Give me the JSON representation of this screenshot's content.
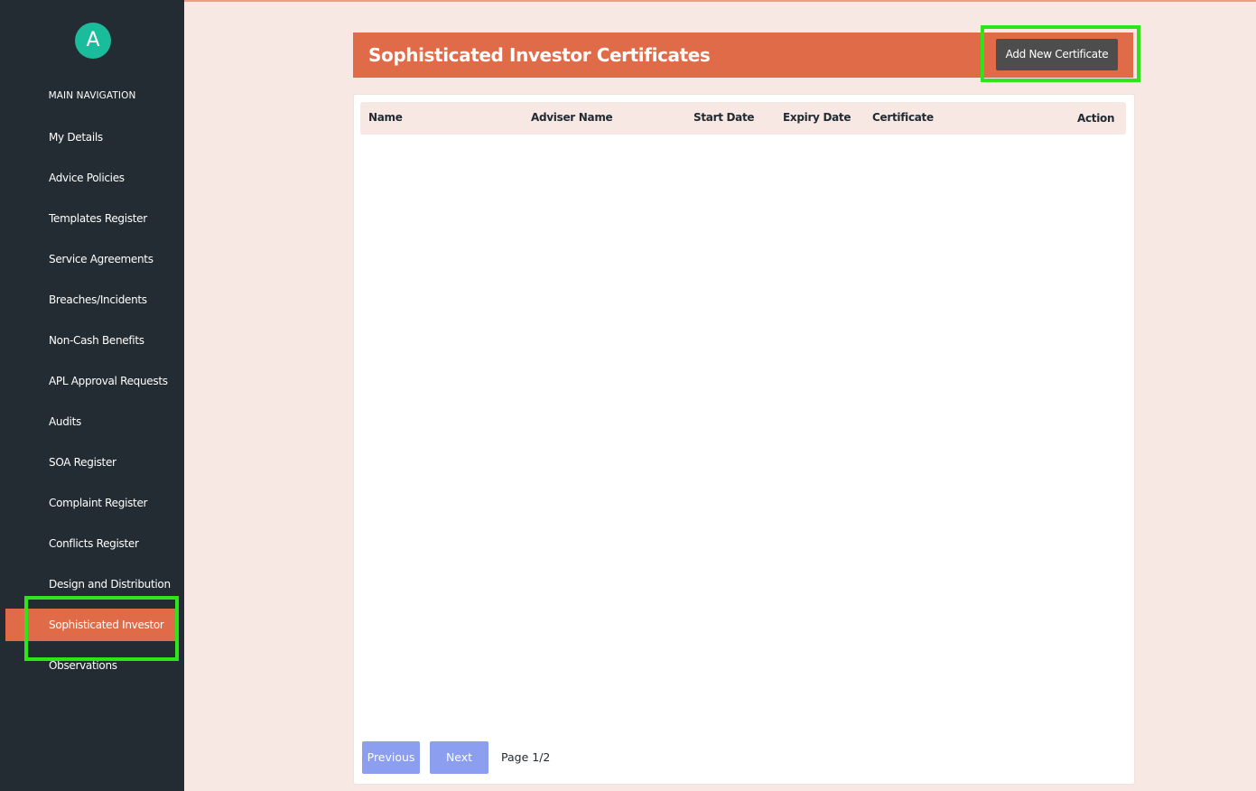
{
  "sidebar": {
    "avatar_letter": "A",
    "heading": "MAIN NAVIGATION",
    "items": [
      {
        "label": "My Details"
      },
      {
        "label": "Advice Policies"
      },
      {
        "label": "Templates Register"
      },
      {
        "label": "Service Agreements"
      },
      {
        "label": "Breaches/Incidents"
      },
      {
        "label": "Non-Cash Benefits"
      },
      {
        "label": "APL Approval Requests"
      },
      {
        "label": "Audits"
      },
      {
        "label": "SOA Register"
      },
      {
        "label": "Complaint Register"
      },
      {
        "label": "Conflicts Register"
      },
      {
        "label": "Design and Distribution"
      },
      {
        "label": "Sophisticated Investor",
        "active": true
      },
      {
        "label": "Observations"
      }
    ]
  },
  "header": {
    "title": "Sophisticated Investor Certificates",
    "add_button_label": "Add New Certificate"
  },
  "table": {
    "columns": [
      "Name",
      "Adviser Name",
      "Start Date",
      "Expiry Date",
      "Certificate",
      "Action"
    ],
    "rows": []
  },
  "pagination": {
    "previous_label": "Previous",
    "next_label": "Next",
    "page_text": "Page 1/2"
  },
  "colors": {
    "sidebar_bg": "#232c32",
    "accent": "#e06b48",
    "avatar": "#1abc9c",
    "page_bg": "#f7e8e3",
    "pager_button": "#8b9ef0",
    "highlight": "#2ee51a"
  }
}
